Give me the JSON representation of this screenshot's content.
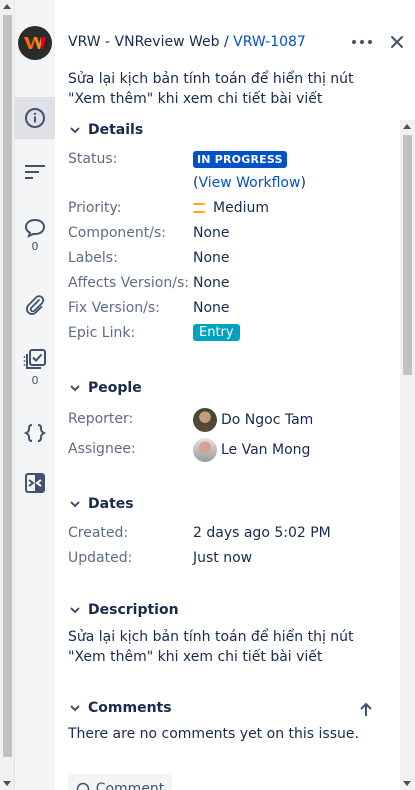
{
  "header": {
    "project": "VRW - VNReview Web",
    "separator": " / ",
    "issue_key": "VRW-1087",
    "summary": "Sửa lại kịch bản tính toán để hiển thị nút \"Xem thêm\" khi xem chi tiết bài viết"
  },
  "rail": {
    "comments_count": "0",
    "checklist_count": "0"
  },
  "details": {
    "heading": "Details",
    "status_label": "Status:",
    "status_value": "IN PROGRESS",
    "workflow_open": "(",
    "workflow_link": "View Workflow",
    "workflow_close": ")",
    "priority_label": "Priority:",
    "priority_value": "Medium",
    "component_label": "Component/s:",
    "component_value": "None",
    "labels_label": "Labels:",
    "labels_value": "None",
    "affects_label": "Affects Version/s:",
    "affects_value": "None",
    "fix_label": "Fix Version/s:",
    "fix_value": "None",
    "epic_label": "Epic Link:",
    "epic_value": "Entry"
  },
  "people": {
    "heading": "People",
    "reporter_label": "Reporter:",
    "reporter_name": "Do Ngoc Tam",
    "assignee_label": "Assignee:",
    "assignee_name": "Le Van Mong"
  },
  "dates": {
    "heading": "Dates",
    "created_label": "Created:",
    "created_value": "2 days ago 5:02 PM",
    "updated_label": "Updated:",
    "updated_value": "Just now"
  },
  "description": {
    "heading": "Description",
    "text": "Sửa lại kịch bản tính toán để hiển thị nút \"Xem thêm\" khi xem chi tiết bài viết"
  },
  "comments": {
    "heading": "Comments",
    "empty_text": "There are no comments yet on this issue.",
    "button_label": "Comment"
  },
  "colors": {
    "status_blue": "#0052cc",
    "epic_teal": "#00a3bf",
    "priority_yellow": "#ffab00",
    "link": "#0052cc"
  },
  "icons": [
    "info-icon",
    "activity-icon",
    "comment-icon",
    "attachment-icon",
    "checklist-icon",
    "code-icon",
    "switch-icon",
    "more-icon",
    "close-icon",
    "chevron-down-icon",
    "arrow-up-icon"
  ]
}
